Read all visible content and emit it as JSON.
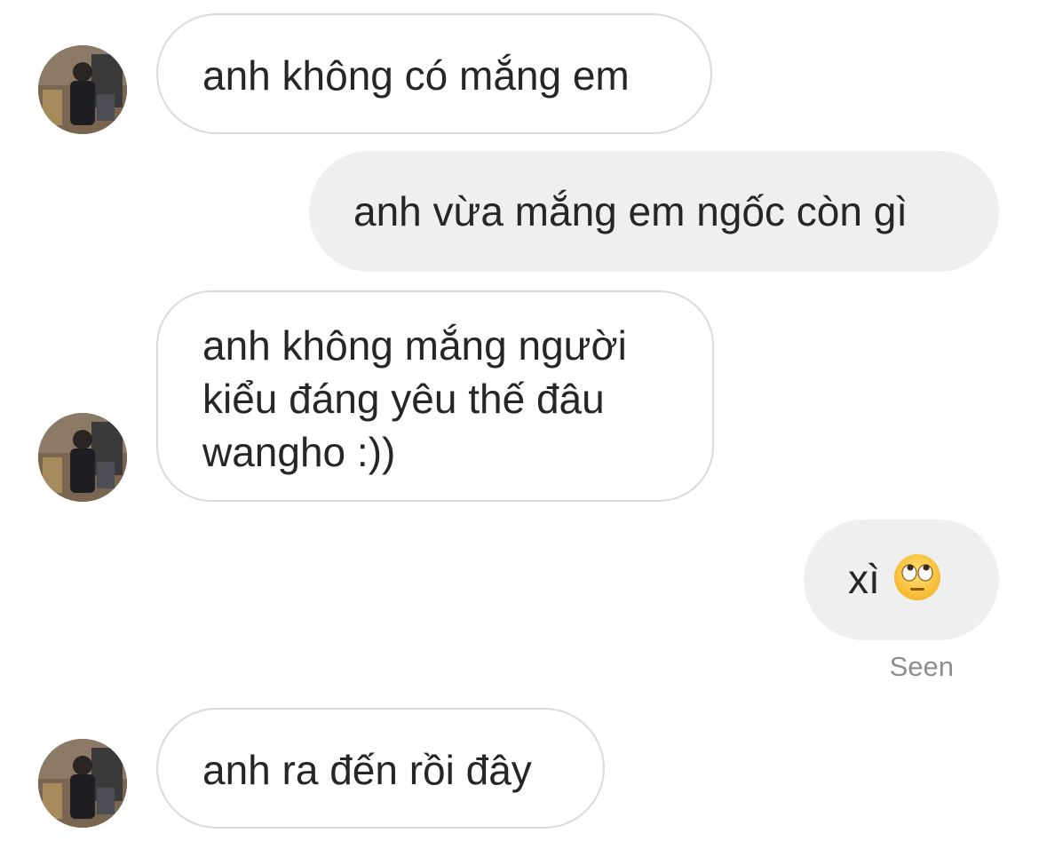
{
  "messages": [
    {
      "sender": "other",
      "lines": [
        "anh không có mắng em"
      ]
    },
    {
      "sender": "me",
      "lines": [
        "anh vừa mắng em ngốc còn gì"
      ]
    },
    {
      "sender": "other",
      "lines": [
        "anh không mắng người",
        "kiểu đáng yêu thế đâu",
        "wangho :))"
      ]
    },
    {
      "sender": "me",
      "text": "xì",
      "emoji": "eye-roll-emoji"
    },
    {
      "sender": "other",
      "lines": [
        "anh ra đến rồi đây"
      ]
    }
  ],
  "status": {
    "seen_label": "Seen"
  },
  "colors": {
    "incoming_bubble_border": "#dbdbdb",
    "outgoing_bubble_bg": "#efefef",
    "text": "#262626",
    "muted": "#8e8e8e"
  }
}
